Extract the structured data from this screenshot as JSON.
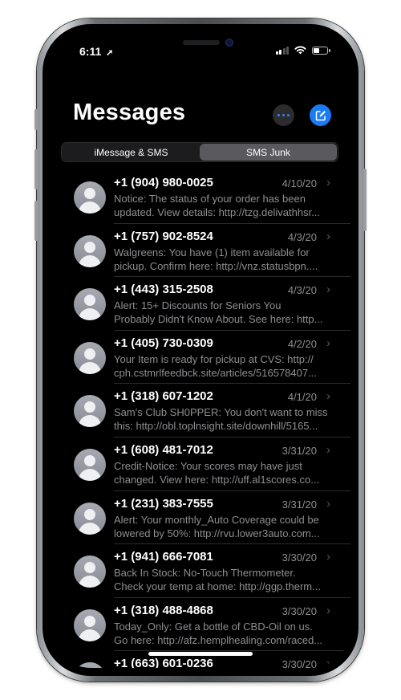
{
  "status_bar": {
    "time": "6:11",
    "location_arrow": "location-arrow-icon"
  },
  "header": {
    "title": "Messages"
  },
  "segments": {
    "imessage_label": "iMessage & SMS",
    "junk_label": "SMS Junk",
    "selected": "SMS Junk"
  },
  "colors": {
    "accent": "#1a7cf5",
    "background": "#000000",
    "secondary_text": "#8e8e93"
  },
  "messages": [
    {
      "sender": "+1 (904) 980-0025",
      "date": "4/10/20",
      "line1": "Notice: The status of your order has been",
      "line2": "updated. View details: http://tzg.delivathhsr..."
    },
    {
      "sender": "+1 (757) 902-8524",
      "date": "4/3/20",
      "line1": "Walgreens: You have (1) item available for",
      "line2": "pickup. Confirm here: http://vnz.statusbpn...."
    },
    {
      "sender": "+1 (443) 315-2508",
      "date": "4/3/20",
      "line1": "Alert: 15+ Discounts for Seniors You",
      "line2": "Probably Didn't Know About. See here: http..."
    },
    {
      "sender": "+1 (405) 730-0309",
      "date": "4/2/20",
      "line1": "Your Item is ready for pickup at CVS: http://",
      "line2": "cph.cstmrlfeedbck.site/articles/516578407..."
    },
    {
      "sender": "+1 (318) 607-1202",
      "date": "4/1/20",
      "line1": "Sam's Club SH0PPER: You don't want to miss",
      "line2": "this: http://obl.toplnsight.site/downhill/5165..."
    },
    {
      "sender": "+1 (608) 481-7012",
      "date": "3/31/20",
      "line1": "Credit-Notice: Your scores may have just",
      "line2": "changed. View here: http://uff.al1scores.co..."
    },
    {
      "sender": "+1 (231) 383-7555",
      "date": "3/31/20",
      "line1": "Alert: Your monthly_Auto Coverage could be",
      "line2": "lowered by 50%: http://rvu.lower3auto.com..."
    },
    {
      "sender": "+1 (941) 666-7081",
      "date": "3/30/20",
      "line1": "Back In Stock: No-Touch Thermometer.",
      "line2": "Check your temp at home: http://ggp.therm..."
    },
    {
      "sender": "+1 (318) 488-4868",
      "date": "3/30/20",
      "line1": "Today_Only: Get a bottle of CBD-Oil on us.",
      "line2": "Go here: http://afz.hemplhealing.com/raced..."
    },
    {
      "sender": "+1 (663) 601-0236",
      "date": "3/30/20",
      "line1": "",
      "line2": ""
    }
  ]
}
